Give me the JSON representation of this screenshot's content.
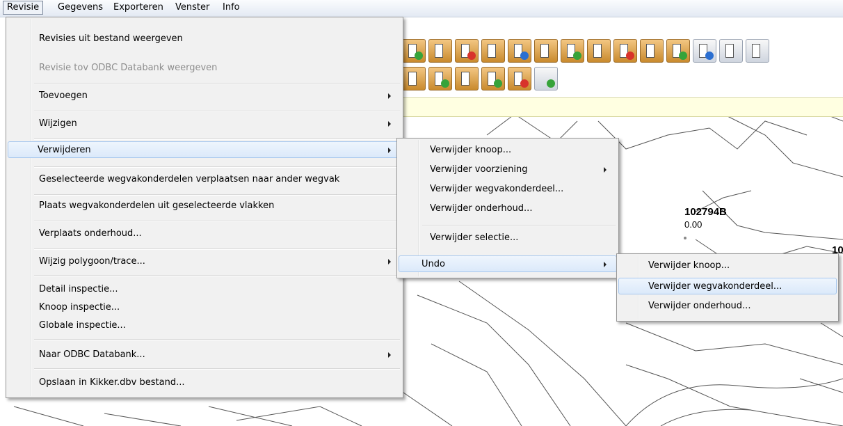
{
  "menubar": [
    "Revisie",
    "Gegevens",
    "Exporteren",
    "Venster",
    "Info"
  ],
  "map": {
    "node_label": "102794B",
    "node_value": "0.00",
    "partial_label": "10"
  },
  "main_menu": {
    "items": [
      {
        "label": "Revisies uit bestand weergeven"
      },
      {
        "label": "Revisie tov ODBC Databank weergeven"
      },
      {
        "label": "Toevoegen"
      },
      {
        "label": "Wijzigen"
      },
      {
        "label": "Verwijderen"
      },
      {
        "label": "Geselecteerde wegvakonderdelen verplaatsen naar ander wegvak"
      },
      {
        "label": "Plaats wegvakonderdelen uit geselecteerde vlakken"
      },
      {
        "label": "Verplaats onderhoud..."
      },
      {
        "label": "Wijzig polygoon/trace..."
      },
      {
        "label": "Detail inspectie..."
      },
      {
        "label": "Knoop inspectie..."
      },
      {
        "label": "Globale inspectie..."
      },
      {
        "label": "Naar ODBC Databank..."
      },
      {
        "label": "Opslaan in Kikker.dbv bestand..."
      }
    ]
  },
  "delete_menu": {
    "items": [
      {
        "label": "Verwijder knoop..."
      },
      {
        "label": "Verwijder voorziening"
      },
      {
        "label": "Verwijder wegvakonderdeel..."
      },
      {
        "label": "Verwijder onderhoud..."
      },
      {
        "label": "Verwijder selectie..."
      },
      {
        "label": "Undo"
      }
    ]
  },
  "undo_menu": {
    "items": [
      {
        "label": "Verwijder knoop..."
      },
      {
        "label": "Verwijder wegvakonderdeel..."
      },
      {
        "label": "Verwijder onderhoud..."
      }
    ]
  }
}
